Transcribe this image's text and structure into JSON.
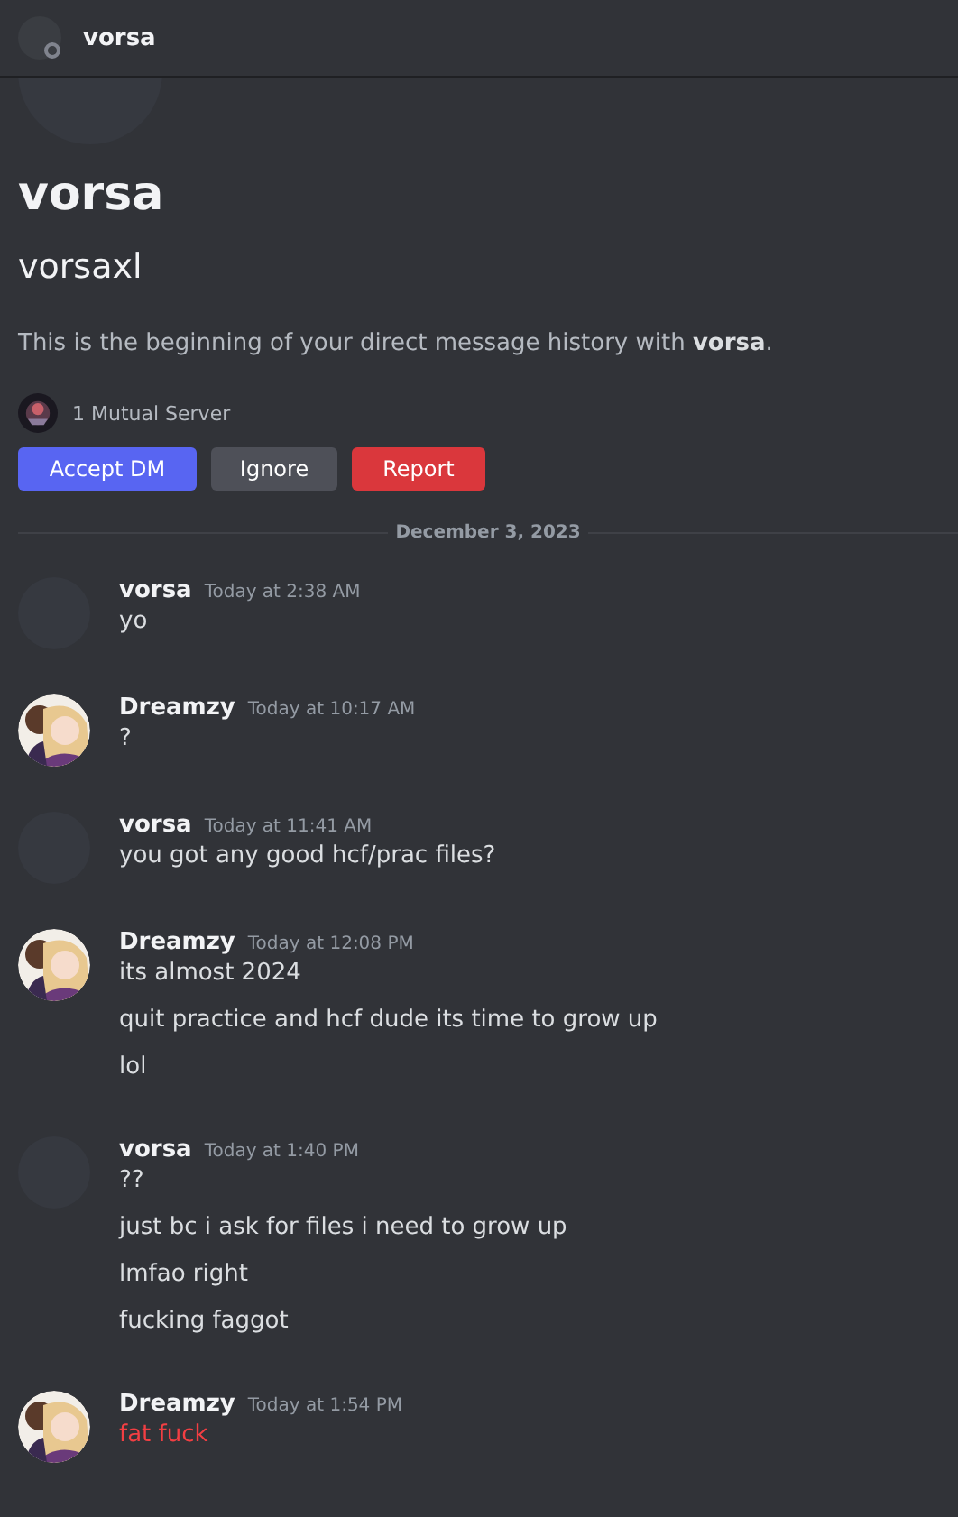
{
  "header": {
    "name": "vorsa",
    "online": false
  },
  "profile": {
    "display_name": "vorsa",
    "username": "vorsaxl",
    "intro": "This is the beginning of your direct message history with **vorsa**.",
    "mutual": "1 Mutual Server"
  },
  "buttons": [
    {
      "label": "Accept DM",
      "kind": "primary"
    },
    {
      "label": "Ignore",
      "kind": "secondary"
    },
    {
      "label": "Report",
      "kind": "danger"
    }
  ],
  "date_divider": "December 3, 2023",
  "messages": [
    {
      "author": "vorsa",
      "kind": "blank",
      "time": "Today at 2:38 AM",
      "lines": [
        {
          "text": "yo",
          "failed": false
        }
      ]
    },
    {
      "author": "Dreamzy",
      "kind": "picture",
      "time": "Today at 10:17 AM",
      "lines": [
        {
          "text": "?",
          "failed": false
        }
      ]
    },
    {
      "author": "vorsa",
      "kind": "blank",
      "time": "Today at 11:41 AM",
      "lines": [
        {
          "text": "you got any good hcf/prac files?",
          "failed": false
        }
      ]
    },
    {
      "author": "Dreamzy",
      "kind": "picture",
      "time": "Today at 12:08 PM",
      "lines": [
        {
          "text": "its almost 2024",
          "failed": false
        },
        {
          "text": "quit practice and hcf dude its time to grow up",
          "failed": false
        },
        {
          "text": "lol",
          "failed": false
        }
      ]
    },
    {
      "author": "vorsa",
      "kind": "blank",
      "time": "Today at 1:40 PM",
      "lines": [
        {
          "text": "??",
          "failed": false
        },
        {
          "text": "just bc i ask for files i need to grow up",
          "failed": false
        },
        {
          "text": "lmfao right",
          "failed": false
        },
        {
          "text": "fucking faggot",
          "failed": false
        }
      ]
    },
    {
      "author": "Dreamzy",
      "kind": "picture",
      "time": "Today at 1:54 PM",
      "lines": [
        {
          "text": "fat fuck",
          "failed": true
        }
      ]
    }
  ]
}
